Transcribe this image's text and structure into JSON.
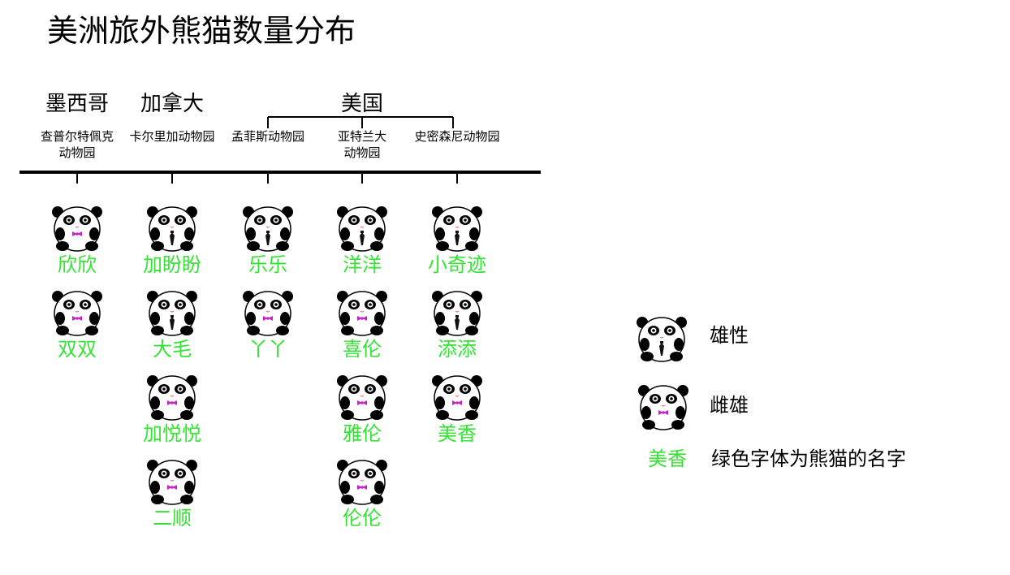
{
  "title": "美洲旅外熊猫数量分布",
  "countries": [
    {
      "name": "墨西哥"
    },
    {
      "name": "加拿大"
    },
    {
      "name": "美国"
    }
  ],
  "zoos": [
    {
      "label": "查普尔特佩克\n动物园",
      "pandas": [
        {
          "name": "欣欣",
          "sex": "female"
        },
        {
          "name": "双双",
          "sex": "female"
        }
      ]
    },
    {
      "label": "卡尔里加动物园",
      "pandas": [
        {
          "name": "加盼盼",
          "sex": "male"
        },
        {
          "name": "大毛",
          "sex": "male"
        },
        {
          "name": "加悦悦",
          "sex": "female"
        },
        {
          "name": "二顺",
          "sex": "female"
        }
      ]
    },
    {
      "label": "孟菲斯动物园",
      "pandas": [
        {
          "name": "乐乐",
          "sex": "male"
        },
        {
          "name": "丫丫",
          "sex": "female"
        }
      ]
    },
    {
      "label": "亚特兰大\n动物园",
      "pandas": [
        {
          "name": "洋洋",
          "sex": "male"
        },
        {
          "name": "喜伦",
          "sex": "female"
        },
        {
          "name": "雅伦",
          "sex": "female"
        },
        {
          "name": "伦伦",
          "sex": "female"
        }
      ]
    },
    {
      "label": "史密森尼动物园",
      "pandas": [
        {
          "name": "小奇迹",
          "sex": "male"
        },
        {
          "name": "添添",
          "sex": "male"
        },
        {
          "name": "美香",
          "sex": "female"
        }
      ]
    }
  ],
  "legend": {
    "male_label": "雄性",
    "female_label": "雌雄",
    "sample_name": "美香",
    "name_note": "绿色字体为熊猫的名字"
  },
  "colors": {
    "name_green": "#35e335",
    "female_bow": "#cc22cc",
    "male_tie": "#111111"
  }
}
